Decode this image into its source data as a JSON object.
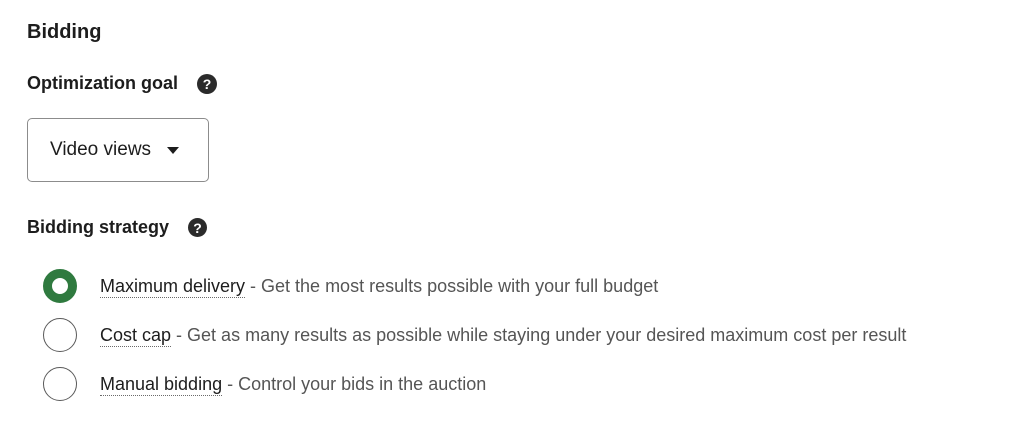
{
  "section": {
    "title": "Bidding"
  },
  "optimization": {
    "label": "Optimization goal",
    "help_icon": "?",
    "selected_value": "Video views"
  },
  "strategy": {
    "label": "Bidding strategy",
    "help_icon": "?",
    "options": [
      {
        "name": "Maximum delivery",
        "description": " - Get the most results possible with your full budget",
        "selected": true
      },
      {
        "name": "Cost cap",
        "description": " - Get as many results as possible while staying under your desired maximum cost per result",
        "selected": false
      },
      {
        "name": "Manual bidding",
        "description": " - Control your bids in the auction",
        "selected": false
      }
    ]
  },
  "colors": {
    "accent": "#2f7a3f",
    "text": "#1d1d1d",
    "muted": "#555555"
  }
}
